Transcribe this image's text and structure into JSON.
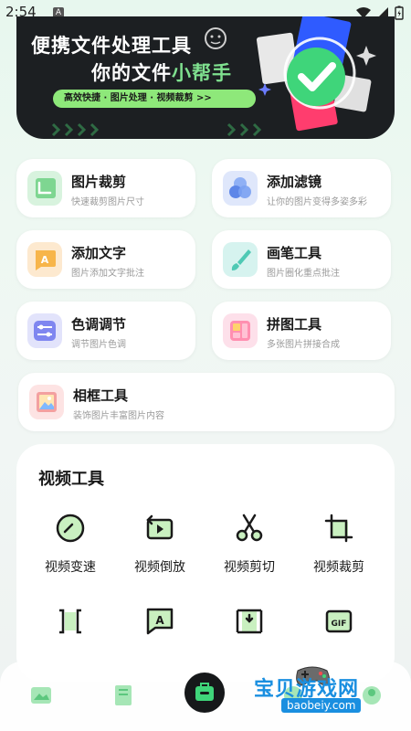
{
  "status": {
    "time": "2:54",
    "a_icon": "A"
  },
  "banner": {
    "line1": "便携文件处理工具",
    "line2_prefix": "你的文件",
    "line2_highlight": "小帮手",
    "pill": "高效快捷 · 图片处理 · 视频裁剪   >>"
  },
  "cards": [
    {
      "title": "图片裁剪",
      "sub": "快速裁剪图片尺寸",
      "icon": "crop-icon",
      "color": "#d8f3de"
    },
    {
      "title": "添加滤镜",
      "sub": "让你的图片变得多姿多彩",
      "icon": "filter-icon",
      "color": "#dfe7fb"
    },
    {
      "title": "添加文字",
      "sub": "图片添加文字批注",
      "icon": "text-icon",
      "color": "#fde9cf"
    },
    {
      "title": "画笔工具",
      "sub": "图片圈化重点批注",
      "icon": "brush-icon",
      "color": "#d6f3ef"
    },
    {
      "title": "色调调节",
      "sub": "调节图片色调",
      "icon": "sliders-icon",
      "color": "#e2e3fb"
    },
    {
      "title": "拼图工具",
      "sub": "多张图片拼接合成",
      "icon": "collage-icon",
      "color": "#fde0ea"
    },
    {
      "title": "相框工具",
      "sub": "装饰图片丰富图片内容",
      "icon": "frame-icon",
      "color": "#fde3e3"
    }
  ],
  "video": {
    "title": "视频工具",
    "tools": [
      {
        "label": "视频变速",
        "icon": "speed-icon"
      },
      {
        "label": "视频倒放",
        "icon": "reverse-icon"
      },
      {
        "label": "视频剪切",
        "icon": "scissors-icon"
      },
      {
        "label": "视频裁剪",
        "icon": "video-crop-icon"
      }
    ],
    "row2_icons": [
      "split-icon",
      "subtitle-icon",
      "compress-icon",
      "gif-icon"
    ]
  },
  "watermark": {
    "text": "宝贝游戏网",
    "url": "baobeiy.com"
  }
}
